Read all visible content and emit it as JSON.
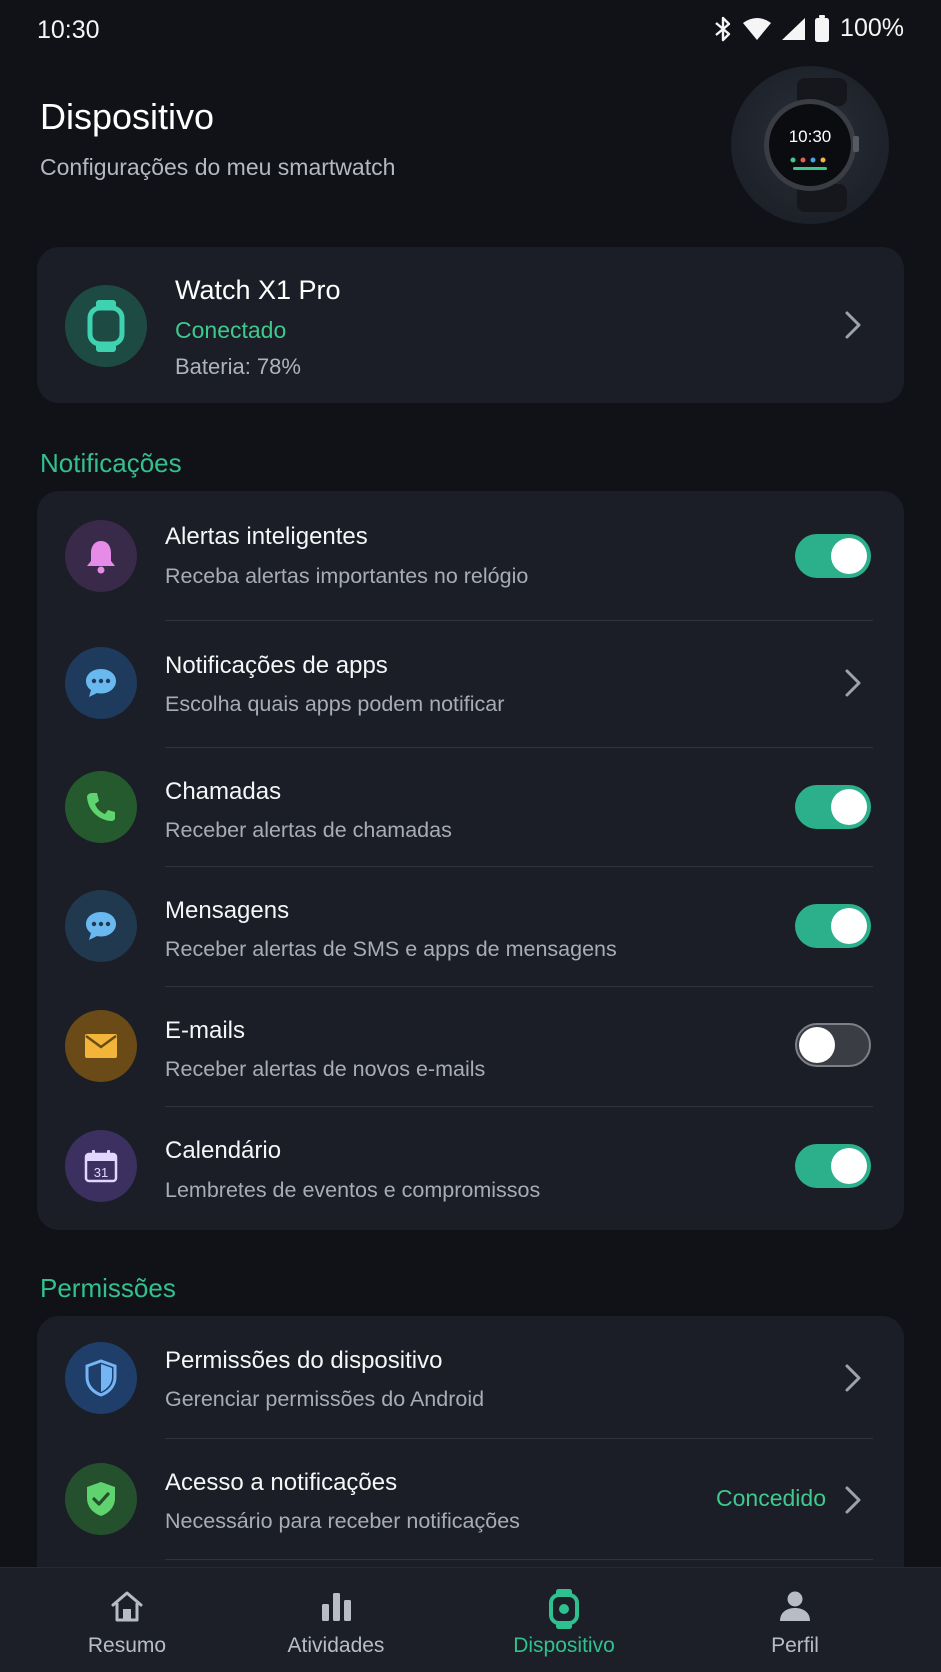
{
  "status_bar": {
    "time": "10:30",
    "battery": "100%"
  },
  "header": {
    "title": "Dispositivo",
    "subtitle": "Configurações do meu smartwatch",
    "watch_time": "10:30"
  },
  "device": {
    "name": "Watch X1 Pro",
    "status": "Conectado",
    "battery": "Bateria: 78%"
  },
  "notifications": {
    "section_title": "Notificações",
    "items": [
      {
        "title": "Alertas inteligentes",
        "subtitle": "Receba alertas importantes no relógio",
        "control": "toggle",
        "enabled": true
      },
      {
        "title": "Notificações de apps",
        "subtitle": "Escolha quais apps podem notificar",
        "control": "chevron"
      },
      {
        "title": "Chamadas",
        "subtitle": "Receber alertas de chamadas",
        "control": "toggle",
        "enabled": true
      },
      {
        "title": "Mensagens",
        "subtitle": "Receber alertas de SMS e apps de mensagens",
        "control": "toggle",
        "enabled": true
      },
      {
        "title": "E-mails",
        "subtitle": "Receber alertas de novos e-mails",
        "control": "toggle",
        "enabled": false
      },
      {
        "title": "Calendário",
        "subtitle": "Lembretes de eventos e compromissos",
        "control": "toggle",
        "enabled": true,
        "calendar_day": "31"
      }
    ]
  },
  "permissions": {
    "section_title": "Permissões",
    "items": [
      {
        "title": "Permissões do dispositivo",
        "subtitle": "Gerenciar permissões do Android"
      },
      {
        "title": "Acesso a notificações",
        "subtitle": "Necessário para receber notificações",
        "status": "Concedido"
      }
    ]
  },
  "bottom_nav": {
    "items": [
      {
        "label": "Resumo",
        "icon": "home-icon",
        "active": false
      },
      {
        "label": "Atividades",
        "icon": "bar-chart-icon",
        "active": false
      },
      {
        "label": "Dispositivo",
        "icon": "watch-icon",
        "active": true
      },
      {
        "label": "Perfil",
        "icon": "person-icon",
        "active": false
      }
    ]
  },
  "colors": {
    "accent": "#2bb08b",
    "status_green": "#3ec98d",
    "background": "#101217",
    "card": "#1b1e26"
  }
}
